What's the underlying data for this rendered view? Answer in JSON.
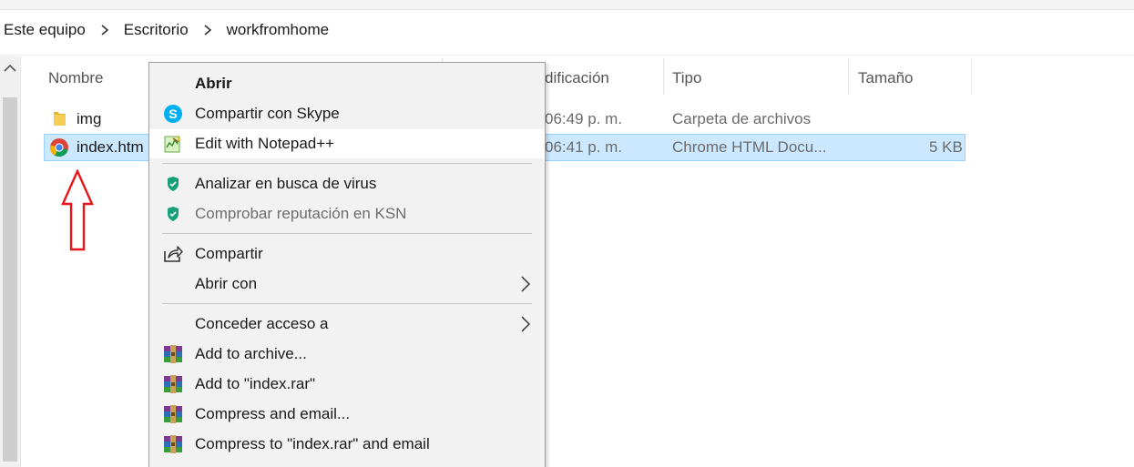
{
  "breadcrumb": [
    "Este equipo",
    "Escritorio",
    "workfromhome"
  ],
  "columns": {
    "name": "Nombre",
    "modified": "dificación",
    "type": "Tipo",
    "size": "Tamaño"
  },
  "files": [
    {
      "name": "img",
      "modified": "06:49 p. m.",
      "type": "Carpeta de archivos",
      "size": "",
      "icon": "folder-icon"
    },
    {
      "name": "index.htm",
      "modified": "06:41 p. m.",
      "type": "Chrome HTML Docu...",
      "size": "5 KB",
      "icon": "chrome-icon"
    }
  ],
  "menu": {
    "items": [
      {
        "label": "Abrir",
        "bold": true
      },
      {
        "label": "Compartir con Skype",
        "icon": "skype-icon"
      },
      {
        "label": "Edit with Notepad++",
        "icon": "notepadpp-icon"
      },
      {
        "label": "Analizar en busca de virus",
        "icon": "kaspersky-shield-icon"
      },
      {
        "label": "Comprobar reputación en KSN",
        "icon": "kaspersky-shield-icon",
        "disabled": true
      },
      {
        "label": "Compartir",
        "icon": "share-icon"
      },
      {
        "label": "Abrir con",
        "submenu": true
      },
      {
        "label": "Conceder acceso a",
        "submenu": true
      },
      {
        "label": "Add to archive...",
        "icon": "winrar-icon"
      },
      {
        "label": "Add to \"index.rar\"",
        "icon": "winrar-icon"
      },
      {
        "label": "Compress and email...",
        "icon": "winrar-icon"
      },
      {
        "label": "Compress to \"index.rar\" and email",
        "icon": "winrar-icon"
      }
    ]
  },
  "colors": {
    "selection": "#cce8ff",
    "selection_border": "#99d1ff",
    "annotation": "#e8141b",
    "menu_bg": "#f2f2f2"
  }
}
